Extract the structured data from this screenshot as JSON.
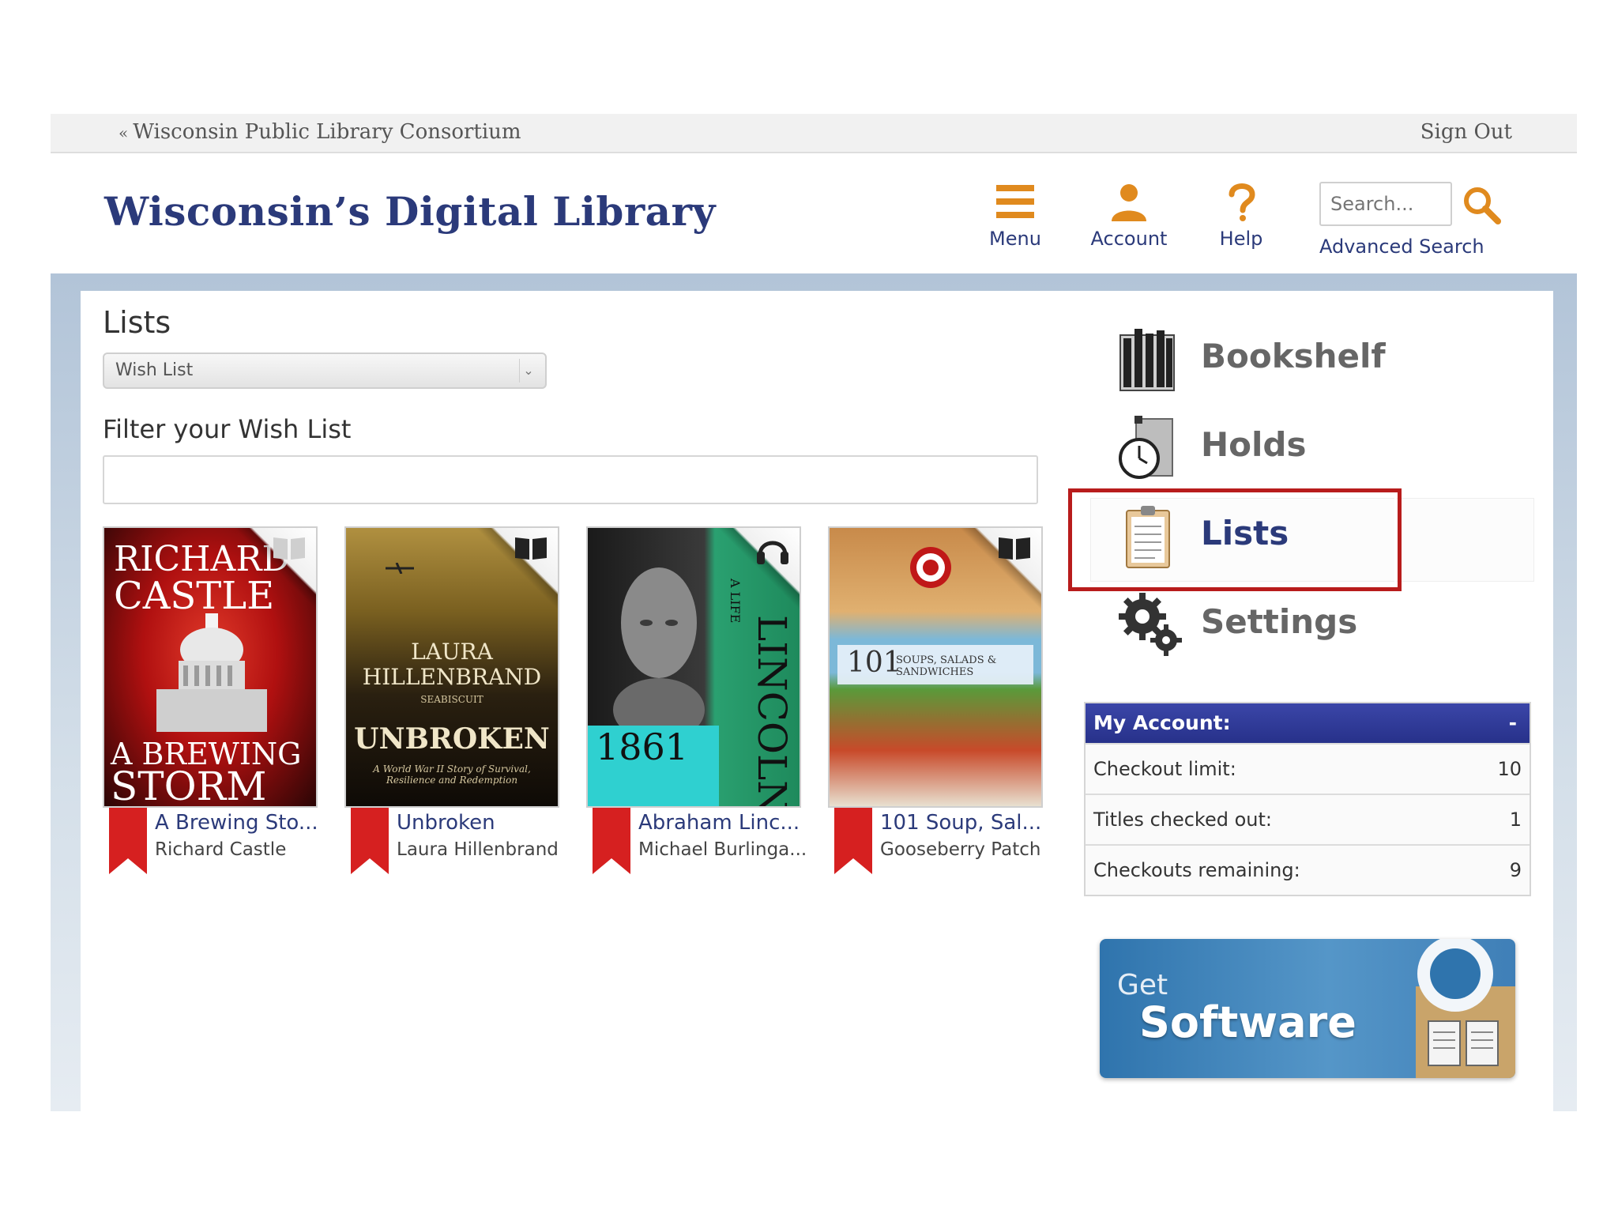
{
  "topbar": {
    "consortium_chevron": "«",
    "consortium_link": "Wisconsin Public Library Consortium",
    "sign_out": "Sign Out"
  },
  "header": {
    "logo": "Wisconsin’s Digital Library",
    "nav": {
      "menu_label": "Menu",
      "account_label": "Account",
      "help_label": "Help"
    },
    "search": {
      "placeholder": "Search...",
      "advanced": "Advanced Search"
    },
    "accent_color": "#2b3a7a",
    "icon_color": "#e08a1e"
  },
  "main": {
    "lists_title": "Lists",
    "list_select": {
      "selected": "Wish List",
      "arrow": "⌄"
    },
    "filter_label": "Filter your Wish List",
    "filter_value": "",
    "books": [
      {
        "title": "A Brewing Sto...",
        "author": "Richard Castle",
        "format_icon": "book-icon",
        "cover_lines": [
          "RICHARD",
          "CASTLE",
          "A BREWING",
          "STORM"
        ]
      },
      {
        "title": "Unbroken",
        "author": "Laura Hillenbrand",
        "format_icon": "book-icon",
        "cover_lines": [
          "LAURA",
          "HILLENBRAND",
          "SEABISCUIT",
          "UNBROKEN",
          "A World War II Story of Survival, Resilience and Redemption"
        ]
      },
      {
        "title": "Abraham Linc...",
        "author": "Michael Burlinga...",
        "format_icon": "headphones-icon",
        "cover_lines": [
          "LINCOLN",
          "A LIFE",
          "1861"
        ]
      },
      {
        "title": "101 Soup, Sal...",
        "author": "Gooseberry Patch",
        "format_icon": "book-icon",
        "cover_lines": [
          "101",
          "SOUPS, SALADS & SANDWICHES"
        ]
      }
    ]
  },
  "sidebar": {
    "items": [
      {
        "label": "Bookshelf",
        "icon": "bookshelf-icon"
      },
      {
        "label": "Holds",
        "icon": "stopwatch-icon"
      },
      {
        "label": "Lists",
        "icon": "clipboard-icon",
        "active": true
      },
      {
        "label": "Settings",
        "icon": "gears-icon"
      }
    ],
    "highlight_color": "#b81c1c"
  },
  "account": {
    "title": "My Account:",
    "toggle": "-",
    "rows": [
      {
        "label": "Checkout limit:",
        "value": "10"
      },
      {
        "label": "Titles checked out:",
        "value": "1"
      },
      {
        "label": "Checkouts remaining:",
        "value": "9"
      }
    ]
  },
  "banner": {
    "line1": "Get",
    "line2": "Software"
  }
}
